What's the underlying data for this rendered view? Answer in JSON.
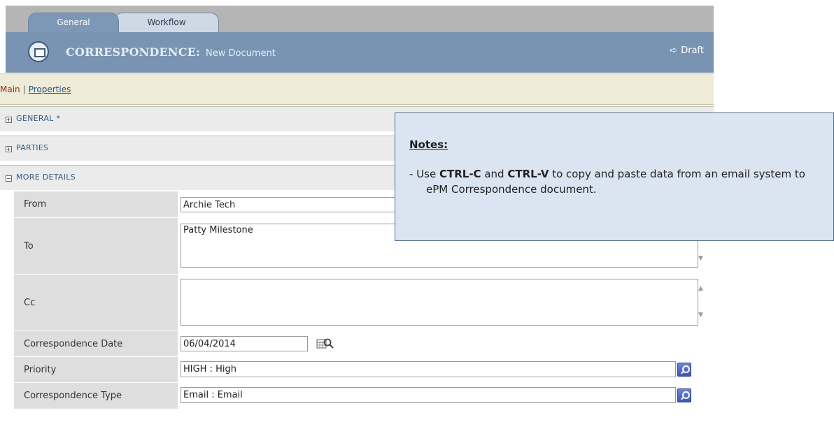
{
  "tabs": [
    {
      "label": "General",
      "active": true
    },
    {
      "label": "Workflow",
      "active": false
    }
  ],
  "header": {
    "title": "CORRESPONDENCE:",
    "subtitle": "New Document",
    "status": "Draft"
  },
  "subnav": {
    "main": "Main",
    "separator": "|",
    "properties": "Properties"
  },
  "sections": {
    "general": "GENERAL *",
    "parties": "PARTIES",
    "more_details": "MORE DETAILS"
  },
  "form": {
    "from": {
      "label": "From",
      "value": "Archie Tech"
    },
    "to": {
      "label": "To",
      "value": "Patty Milestone"
    },
    "cc": {
      "label": "Cc",
      "value": ""
    },
    "date": {
      "label": "Correspondence Date",
      "value": "06/04/2014"
    },
    "priority": {
      "label": "Priority",
      "value": "HIGH : High"
    },
    "type": {
      "label": "Correspondence Type",
      "value": "Email : Email"
    }
  },
  "notes": {
    "heading": "Notes:",
    "prefix": "-  Use ",
    "key1": "CTRL-C",
    "mid": " and ",
    "key2": "CTRL-V",
    "rest": "  to copy and paste  data from an email system to ePM Correspondence document."
  },
  "colors": {
    "header_bg": "#7894b2",
    "subnav_bg": "#eeebd9",
    "notes_bg": "#dbe5f1",
    "label_bg": "#dedede"
  }
}
